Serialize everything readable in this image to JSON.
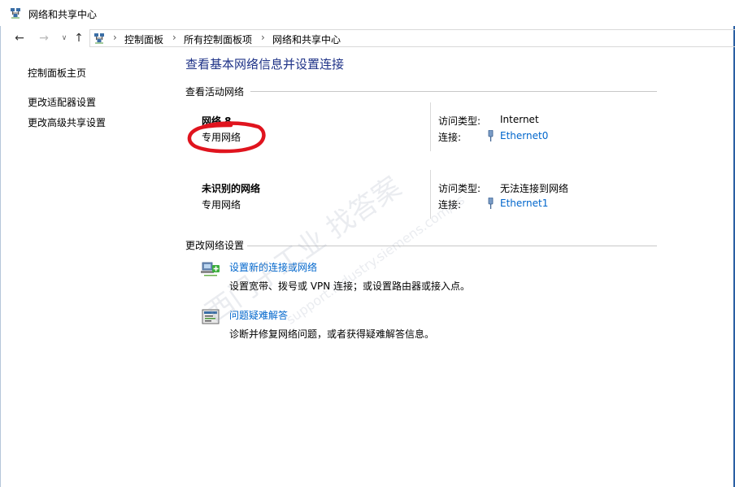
{
  "window": {
    "title": "网络和共享中心"
  },
  "breadcrumb": [
    "控制面板",
    "所有控制面板项",
    "网络和共享中心"
  ],
  "sidebar": {
    "items": [
      {
        "label": "控制面板主页"
      },
      {
        "label": "更改适配器设置"
      },
      {
        "label": "更改高级共享设置"
      }
    ]
  },
  "main": {
    "title": "查看基本网络信息并设置连接",
    "active_label": "查看活动网络",
    "networks": [
      {
        "name": "网络 8",
        "type": "专用网络",
        "access_label": "访问类型:",
        "access_value": "Internet",
        "conn_label": "连接:",
        "conn_value": "Ethernet0"
      },
      {
        "name": "未识别的网络",
        "type": "专用网络",
        "access_label": "访问类型:",
        "access_value": "无法连接到网络",
        "conn_label": "连接:",
        "conn_value": "Ethernet1"
      }
    ],
    "change_label": "更改网络设置",
    "tasks": [
      {
        "link": "设置新的连接或网络",
        "desc": "设置宽带、拨号或 VPN 连接；或设置路由器或接入点。"
      },
      {
        "link": "问题疑难解答",
        "desc": "诊断并修复网络问题，或者获得疑难解答信息。"
      }
    ]
  },
  "watermark": {
    "main": "西门子工业 找答案",
    "url": "support.industry.siemens.com/cs"
  },
  "colors": {
    "title_blue": "#1e3287",
    "link_blue": "#0066cc",
    "annotation_red": "#e0141e"
  },
  "icons": [
    "network-center-icon",
    "back-arrow-icon",
    "forward-arrow-icon",
    "recent-dropdown-icon",
    "up-arrow-icon",
    "ethernet-icon",
    "new-connection-icon",
    "troubleshoot-icon"
  ]
}
